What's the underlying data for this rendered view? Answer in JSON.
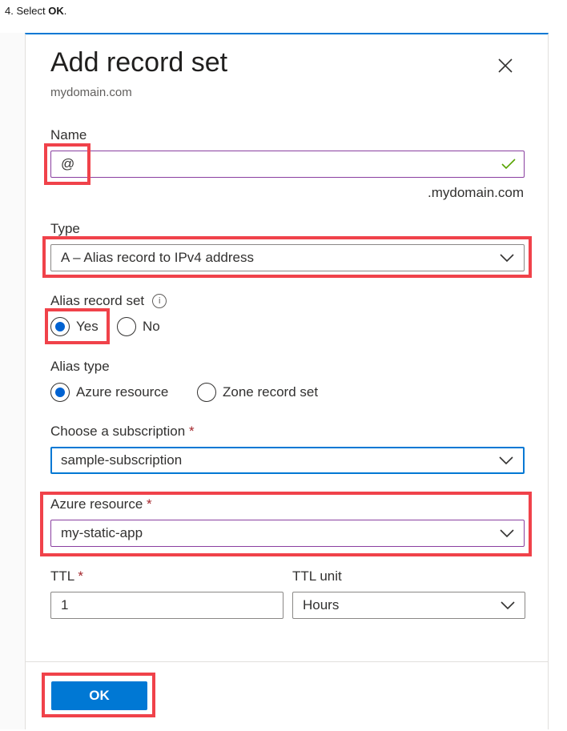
{
  "instruction": {
    "prefix": "4. Select ",
    "bold": "OK",
    "suffix": "."
  },
  "dialog": {
    "title": "Add record set",
    "subtitle": "mydomain.com",
    "close_icon": "close-icon"
  },
  "name_field": {
    "label": "Name",
    "value": "@",
    "suffix": ".mydomain.com",
    "valid_icon": "checkmark-icon"
  },
  "type_field": {
    "label": "Type",
    "value": "A – Alias record to IPv4 address"
  },
  "alias_record_set": {
    "label": "Alias record set",
    "info_icon": "info-icon",
    "options": [
      "Yes",
      "No"
    ],
    "selected": "Yes"
  },
  "alias_type": {
    "label": "Alias type",
    "options": [
      "Azure resource",
      "Zone record set"
    ],
    "selected": "Azure resource"
  },
  "subscription": {
    "label": "Choose a subscription",
    "required": "*",
    "value": "sample-subscription"
  },
  "azure_resource": {
    "label": "Azure resource",
    "required": "*",
    "value": "my-static-app"
  },
  "ttl": {
    "label": "TTL",
    "required": "*",
    "value": "1"
  },
  "ttl_unit": {
    "label": "TTL unit",
    "value": "Hours"
  },
  "footer": {
    "ok_label": "OK"
  },
  "colors": {
    "accent": "#0078d4",
    "highlight": "#f0424a",
    "required": "#a4262c",
    "valid": "#57a300"
  }
}
